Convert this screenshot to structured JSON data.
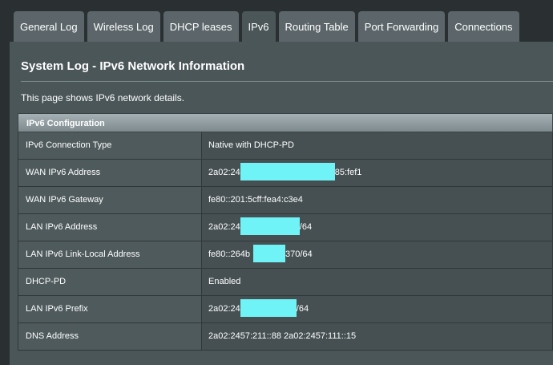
{
  "tabs": [
    {
      "label": "General Log",
      "active": false
    },
    {
      "label": "Wireless Log",
      "active": false
    },
    {
      "label": "DHCP leases",
      "active": false
    },
    {
      "label": "IPv6",
      "active": true
    },
    {
      "label": "Routing Table",
      "active": false
    },
    {
      "label": "Port Forwarding",
      "active": false
    },
    {
      "label": "Connections",
      "active": false
    }
  ],
  "page": {
    "title": "System Log - IPv6 Network Information",
    "description": "This page shows IPv6 network details."
  },
  "config": {
    "header": "IPv6 Configuration",
    "rows": [
      {
        "label": "IPv6 Connection Type",
        "value_prefix": "Native with DHCP-PD",
        "value_suffix": "",
        "redacted": false
      },
      {
        "label": "WAN IPv6 Address",
        "value_prefix": "2a02:24",
        "value_suffix": "85:fef1",
        "redacted": true
      },
      {
        "label": "WAN IPv6 Gateway",
        "value_prefix": "fe80::201:5cff:fea4:c3e4",
        "value_suffix": "",
        "redacted": false
      },
      {
        "label": "LAN IPv6 Address",
        "value_prefix": "2a02:24",
        "value_suffix": "/64",
        "redacted": true
      },
      {
        "label": "LAN IPv6 Link-Local Address",
        "value_prefix": "fe80::264b",
        "value_suffix": "370/64",
        "redacted": true
      },
      {
        "label": "DHCP-PD",
        "value_prefix": "Enabled",
        "value_suffix": "",
        "redacted": false
      },
      {
        "label": "LAN IPv6 Prefix",
        "value_prefix": "2a02:24",
        "value_suffix": "/64",
        "redacted": true
      },
      {
        "label": "DNS Address",
        "value_prefix": "2a02:2457:211::88 2a02:2457:111::15",
        "value_suffix": "",
        "redacted": false
      }
    ]
  },
  "colors": {
    "background": "#2a3032",
    "panel": "#4b5659",
    "tab": "#5c666a",
    "redaction": "#6ff3f6"
  }
}
